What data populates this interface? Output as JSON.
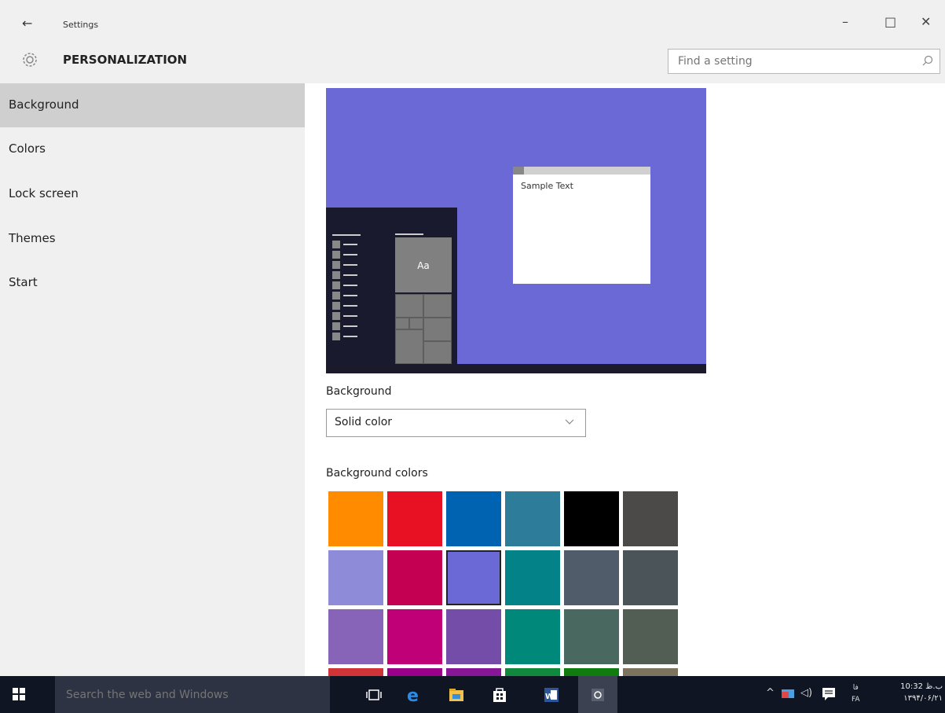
{
  "window": {
    "app_title": "Settings",
    "back_icon": "back-arrow-icon",
    "controls": {
      "minimize": "–",
      "maximize": "□",
      "close": "✕"
    }
  },
  "header": {
    "title": "PERSONALIZATION",
    "search_placeholder": "Find a setting"
  },
  "sidebar": {
    "items": [
      {
        "label": "Background",
        "active": true
      },
      {
        "label": "Colors"
      },
      {
        "label": "Lock screen"
      },
      {
        "label": "Themes"
      },
      {
        "label": "Start"
      }
    ]
  },
  "preview": {
    "sample_text": "Sample Text",
    "tile_text": "Aa",
    "background_color": "#6b69d6"
  },
  "background": {
    "label": "Background",
    "selected_option": "Solid color",
    "colors_label": "Background colors",
    "swatches": [
      [
        "#ff8c00",
        "#e81123",
        "#0063b1",
        "#2d7d9a",
        "#000000",
        "#4c4a48"
      ],
      [
        "#8e8cd8",
        "#c30052",
        "#6b69d6",
        "#038387",
        "#515c6b",
        "#4a5459"
      ],
      [
        "#8764b8",
        "#bf0077",
        "#744da9",
        "#00897b",
        "#486860",
        "#525e54"
      ],
      [
        "#d13438",
        "#9a0089",
        "#881798",
        "#10893e",
        "#107c10",
        "#7e735f"
      ]
    ],
    "selected_swatch": "#6b69d6"
  },
  "taskbar": {
    "search_placeholder": "Search the web and Windows",
    "time": "10:32 ب.ظ",
    "date": "۱۳۹۴/۰۶/۲۱",
    "language": "FA",
    "language_top": "فا",
    "apps": [
      "task-view-icon",
      "edge-icon",
      "file-explorer-icon",
      "store-icon",
      "word-icon",
      "settings-icon"
    ]
  }
}
